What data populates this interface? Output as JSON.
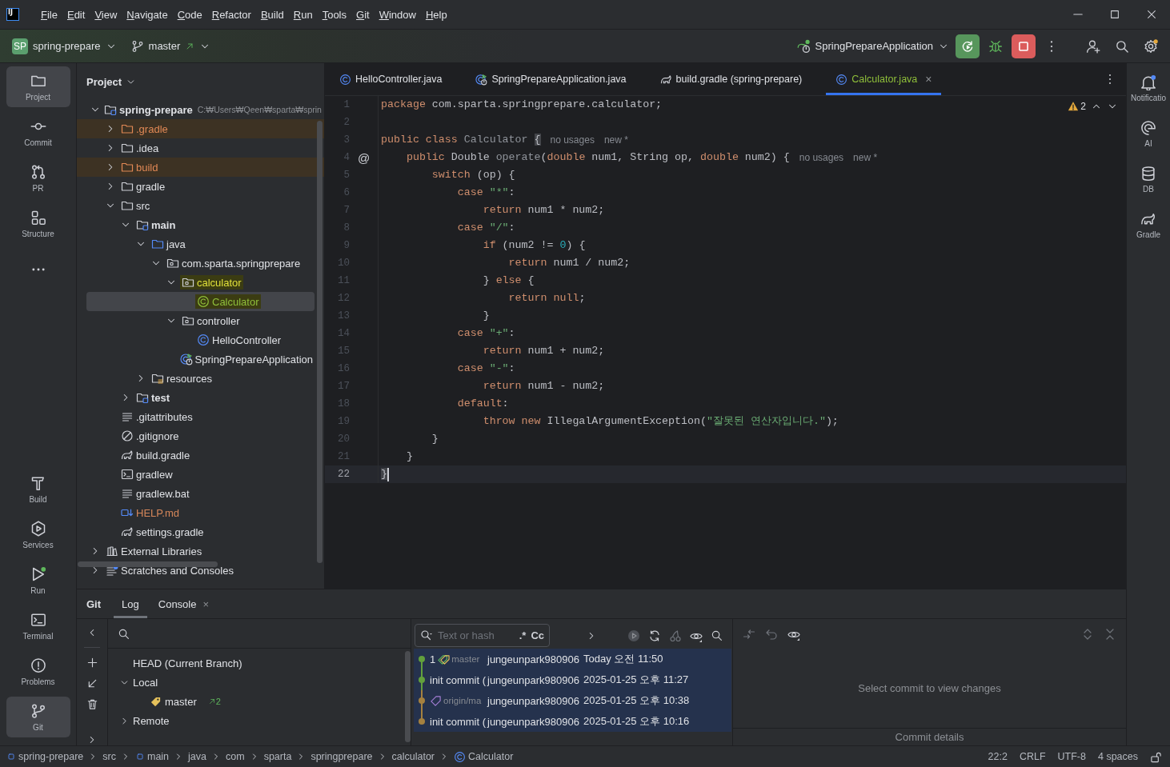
{
  "title_bar": {
    "logo": "IJ",
    "menu": [
      "File",
      "Edit",
      "View",
      "Navigate",
      "Code",
      "Refactor",
      "Build",
      "Run",
      "Tools",
      "Git",
      "Window",
      "Help"
    ]
  },
  "toolbar": {
    "project_badge": "SP",
    "project": "spring-prepare",
    "branch": "master",
    "run_config": "SpringPrepareApplication"
  },
  "left_stripe": {
    "top": [
      {
        "kind": "project",
        "label": "Project",
        "selected": true
      },
      {
        "kind": "commit",
        "label": "Commit",
        "selected": false
      },
      {
        "kind": "pr",
        "label": "PR",
        "selected": false
      },
      {
        "kind": "structure",
        "label": "Structure",
        "selected": false
      },
      {
        "kind": "more",
        "selected": false
      }
    ],
    "bottom": [
      {
        "kind": "build",
        "label": "Build",
        "selected": false
      },
      {
        "kind": "services",
        "label": "Services",
        "selected": false
      },
      {
        "kind": "run",
        "label": "Run",
        "selected": false
      },
      {
        "kind": "terminal",
        "label": "Terminal",
        "selected": false
      },
      {
        "kind": "problems",
        "label": "Problems",
        "selected": false
      },
      {
        "kind": "git",
        "label": "Git",
        "selected": true
      }
    ]
  },
  "right_stripe": [
    {
      "kind": "notifications",
      "label": "Notificatio"
    },
    {
      "kind": "ai",
      "label": "AI"
    },
    {
      "kind": "db",
      "label": "DB"
    },
    {
      "kind": "gradle",
      "label": "Gradle"
    }
  ],
  "project_panel": {
    "title": "Project",
    "tree": [
      {
        "label": "spring-prepare",
        "path": "C:₩Users₩Qeen₩sparta₩sprin",
        "kind": "module",
        "bold": true,
        "highlighted": false,
        "selected": false,
        "expanded": true,
        "children": [
          {
            "label": ".gradle",
            "kind": "folder",
            "excluded": true,
            "highlighted": false,
            "selected": false,
            "expanded": false
          },
          {
            "label": ".idea",
            "kind": "folder",
            "highlighted": false,
            "selected": false,
            "expanded": false
          },
          {
            "label": "build",
            "kind": "folder",
            "excluded": true,
            "highlighted": false,
            "selected": false,
            "expanded": false
          },
          {
            "label": "gradle",
            "kind": "folder",
            "highlighted": false,
            "selected": false,
            "expanded": false
          },
          {
            "label": "src",
            "kind": "folder",
            "highlighted": false,
            "selected": false,
            "expanded": true,
            "children": [
              {
                "label": "main",
                "kind": "module",
                "bold": true,
                "highlighted": false,
                "selected": false,
                "expanded": true,
                "children": [
                  {
                    "label": "java",
                    "kind": "source",
                    "highlighted": false,
                    "selected": false,
                    "expanded": true,
                    "children": [
                      {
                        "label": "com.sparta.springprepare",
                        "kind": "package",
                        "highlighted": false,
                        "selected": false,
                        "expanded": true,
                        "children": [
                          {
                            "label": "calculator",
                            "kind": "package",
                            "highlighted": true,
                            "selected": false,
                            "expanded": true,
                            "children": [
                              {
                                "label": "Calculator",
                                "kind": "class",
                                "added": true,
                                "highlighted": true,
                                "selected": true
                              }
                            ]
                          },
                          {
                            "label": "controller",
                            "kind": "package",
                            "highlighted": false,
                            "selected": false,
                            "expanded": true,
                            "children": [
                              {
                                "label": "HelloController",
                                "kind": "class",
                                "highlighted": false,
                                "selected": false
                              }
                            ]
                          },
                          {
                            "label": "SpringPrepareApplication",
                            "kind": "spring",
                            "highlighted": false,
                            "selected": false
                          }
                        ]
                      }
                    ]
                  },
                  {
                    "label": "resources",
                    "kind": "resources",
                    "highlighted": false,
                    "selected": false,
                    "expanded": false
                  }
                ]
              },
              {
                "label": "test",
                "kind": "module",
                "bold": true,
                "highlighted": false,
                "selected": false,
                "expanded": false
              }
            ]
          },
          {
            "label": ".gitattributes",
            "kind": "text",
            "highlighted": false,
            "selected": false
          },
          {
            "label": ".gitignore",
            "kind": "ignore",
            "highlighted": false,
            "selected": false
          },
          {
            "label": "build.gradle",
            "kind": "gradle",
            "highlighted": false,
            "selected": false
          },
          {
            "label": "gradlew",
            "kind": "terminal",
            "highlighted": false,
            "selected": false
          },
          {
            "label": "gradlew.bat",
            "kind": "text",
            "highlighted": false,
            "selected": false
          },
          {
            "label": "HELP.md",
            "kind": "markdown",
            "unversioned": true,
            "highlighted": false,
            "selected": false
          },
          {
            "label": "settings.gradle",
            "kind": "gradle",
            "highlighted": false,
            "selected": false
          }
        ]
      },
      {
        "label": "External Libraries",
        "kind": "library",
        "highlighted": false,
        "selected": false,
        "expanded": false
      },
      {
        "label": "Scratches and Consoles",
        "kind": "scratches",
        "highlighted": false,
        "selected": false,
        "expanded": false
      }
    ]
  },
  "editor": {
    "tabs": [
      {
        "label": "HelloController.java",
        "kind": "class",
        "selected": false
      },
      {
        "label": "SpringPrepareApplication.java",
        "kind": "spring",
        "selected": false
      },
      {
        "label": "build.gradle (spring-prepare)",
        "kind": "gradle",
        "selected": false
      },
      {
        "label": "Calculator.java",
        "kind": "class",
        "selected": true,
        "close": "×"
      }
    ],
    "warnings": "2",
    "lines": [
      {
        "number": "1",
        "current": false,
        "tokens": [
          {
            "kind": "keyword",
            "text": "package"
          },
          {
            "kind": "plain",
            "text": " com.sparta.springprepare.calculator;"
          }
        ]
      },
      {
        "number": "2",
        "current": false
      },
      {
        "number": "3",
        "current": false,
        "tokens": [
          {
            "kind": "keyword",
            "text": "public class "
          },
          {
            "kind": "unused",
            "text": "Calculator "
          },
          {
            "kind": "brace",
            "text": "{"
          }
        ],
        "hints": [
          "no usages",
          "new *"
        ]
      },
      {
        "number": "4",
        "current": false,
        "gutter_mark": "@",
        "tokens": [
          {
            "kind": "keyword",
            "text": "    public "
          },
          {
            "kind": "plain",
            "text": "Double "
          },
          {
            "kind": "unused",
            "text": "operate"
          },
          {
            "kind": "plain",
            "text": "("
          },
          {
            "kind": "keyword",
            "text": "double "
          },
          {
            "kind": "plain",
            "text": "num1, String op, "
          },
          {
            "kind": "keyword",
            "text": "double "
          },
          {
            "kind": "plain",
            "text": "num2) {"
          }
        ],
        "hints": [
          "no usages",
          "new *"
        ]
      },
      {
        "number": "5",
        "current": false,
        "tokens": [
          {
            "kind": "keyword",
            "text": "        switch"
          },
          {
            "kind": "plain",
            "text": " (op) {"
          }
        ]
      },
      {
        "number": "6",
        "current": false,
        "tokens": [
          {
            "kind": "keyword",
            "text": "            case "
          },
          {
            "kind": "string",
            "text": "\"*\""
          },
          {
            "kind": "plain",
            "text": ":"
          }
        ]
      },
      {
        "number": "7",
        "current": false,
        "tokens": [
          {
            "kind": "keyword",
            "text": "                return "
          },
          {
            "kind": "plain",
            "text": "num1 * num2;"
          }
        ]
      },
      {
        "number": "8",
        "current": false,
        "tokens": [
          {
            "kind": "keyword",
            "text": "            case "
          },
          {
            "kind": "string",
            "text": "\"/\""
          },
          {
            "kind": "plain",
            "text": ":"
          }
        ]
      },
      {
        "number": "9",
        "current": false,
        "tokens": [
          {
            "kind": "keyword",
            "text": "                if "
          },
          {
            "kind": "plain",
            "text": "(num2 != "
          },
          {
            "kind": "number",
            "text": "0"
          },
          {
            "kind": "plain",
            "text": ") {"
          }
        ]
      },
      {
        "number": "10",
        "current": false,
        "tokens": [
          {
            "kind": "keyword",
            "text": "                    return "
          },
          {
            "kind": "plain",
            "text": "num1 / num2;"
          }
        ]
      },
      {
        "number": "11",
        "current": false,
        "tokens": [
          {
            "kind": "plain",
            "text": "                } "
          },
          {
            "kind": "keyword",
            "text": "else "
          },
          {
            "kind": "plain",
            "text": "{"
          }
        ]
      },
      {
        "number": "12",
        "current": false,
        "tokens": [
          {
            "kind": "keyword",
            "text": "                    return null"
          },
          {
            "kind": "plain",
            "text": ";"
          }
        ]
      },
      {
        "number": "13",
        "current": false,
        "tokens": [
          {
            "kind": "plain",
            "text": "                }"
          }
        ]
      },
      {
        "number": "14",
        "current": false,
        "tokens": [
          {
            "kind": "keyword",
            "text": "            case "
          },
          {
            "kind": "string",
            "text": "\"+\""
          },
          {
            "kind": "plain",
            "text": ":"
          }
        ]
      },
      {
        "number": "15",
        "current": false,
        "tokens": [
          {
            "kind": "keyword",
            "text": "                return "
          },
          {
            "kind": "plain",
            "text": "num1 + num2;"
          }
        ]
      },
      {
        "number": "16",
        "current": false,
        "tokens": [
          {
            "kind": "keyword",
            "text": "            case "
          },
          {
            "kind": "string",
            "text": "\"-\""
          },
          {
            "kind": "plain",
            "text": ":"
          }
        ]
      },
      {
        "number": "17",
        "current": false,
        "tokens": [
          {
            "kind": "keyword",
            "text": "                return "
          },
          {
            "kind": "plain",
            "text": "num1 - num2;"
          }
        ]
      },
      {
        "number": "18",
        "current": false,
        "tokens": [
          {
            "kind": "keyword",
            "text": "            default"
          },
          {
            "kind": "plain",
            "text": ":"
          }
        ]
      },
      {
        "number": "19",
        "current": false,
        "tokens": [
          {
            "kind": "keyword",
            "text": "                throw new "
          },
          {
            "kind": "plain",
            "text": "IllegalArgumentException("
          },
          {
            "kind": "string",
            "text": "\"잘못된 연산자입니다.\""
          },
          {
            "kind": "plain",
            "text": ");"
          }
        ]
      },
      {
        "number": "20",
        "current": false,
        "tokens": [
          {
            "kind": "plain",
            "text": "        }"
          }
        ]
      },
      {
        "number": "21",
        "current": false,
        "tokens": [
          {
            "kind": "plain",
            "text": "    }"
          }
        ]
      },
      {
        "number": "22",
        "current": true,
        "tokens": [
          {
            "kind": "brace",
            "text": "}"
          }
        ]
      }
    ]
  },
  "git_panel": {
    "title": "Git",
    "tabs": [
      {
        "label": "Log",
        "selected": true
      },
      {
        "label": "Console",
        "selected": false,
        "close": "×"
      }
    ],
    "branches": [
      {
        "label": "HEAD (Current Branch)"
      },
      {
        "label": "Local",
        "expanded": true,
        "children": [
          {
            "label": "master",
            "outgoing": "2"
          }
        ]
      },
      {
        "label": "Remote",
        "expanded": false
      }
    ],
    "log": {
      "placeholder": "Text or hash",
      "regex": ".*",
      "match_case": "Cc",
      "commits": [
        {
          "message": "1",
          "ref": "master",
          "remote": false,
          "author": "jungeunpark980906",
          "date": "Today 오전 11:50",
          "color": "#62a03c",
          "selected": true
        },
        {
          "message": "init commit (",
          "author": "jungeunpark980906",
          "date": "2025-01-25 오후 11:27",
          "color": "#62a03c",
          "selected": true
        },
        {
          "ref": "origin/ma",
          "remote": true,
          "author": "jungeunpark980906",
          "date": "2025-01-25 오후 10:38",
          "color": "#a5813f",
          "selected": true
        },
        {
          "message": "init commit (",
          "author": "jungeunpark980906",
          "date": "2025-01-25 오후 10:16",
          "color": "#a5813f",
          "selected": true
        }
      ]
    },
    "details": {
      "changes": "Select commit to view changes",
      "details": "Commit details"
    }
  },
  "status_bar": {
    "breadcrumbs": [
      {
        "label": "spring-prepare",
        "kind": "module"
      },
      {
        "label": "src",
        "kind": "folder"
      },
      {
        "label": "main",
        "kind": "module"
      },
      {
        "label": "java",
        "kind": "folder"
      },
      {
        "label": "com",
        "kind": "folder"
      },
      {
        "label": "sparta",
        "kind": "folder"
      },
      {
        "label": "springprepare",
        "kind": "folder"
      },
      {
        "label": "calculator",
        "kind": "folder"
      },
      {
        "label": "Calculator",
        "kind": "class"
      }
    ],
    "items": [
      "22:2",
      "CRLF",
      "UTF-8",
      "4 spaces"
    ]
  }
}
